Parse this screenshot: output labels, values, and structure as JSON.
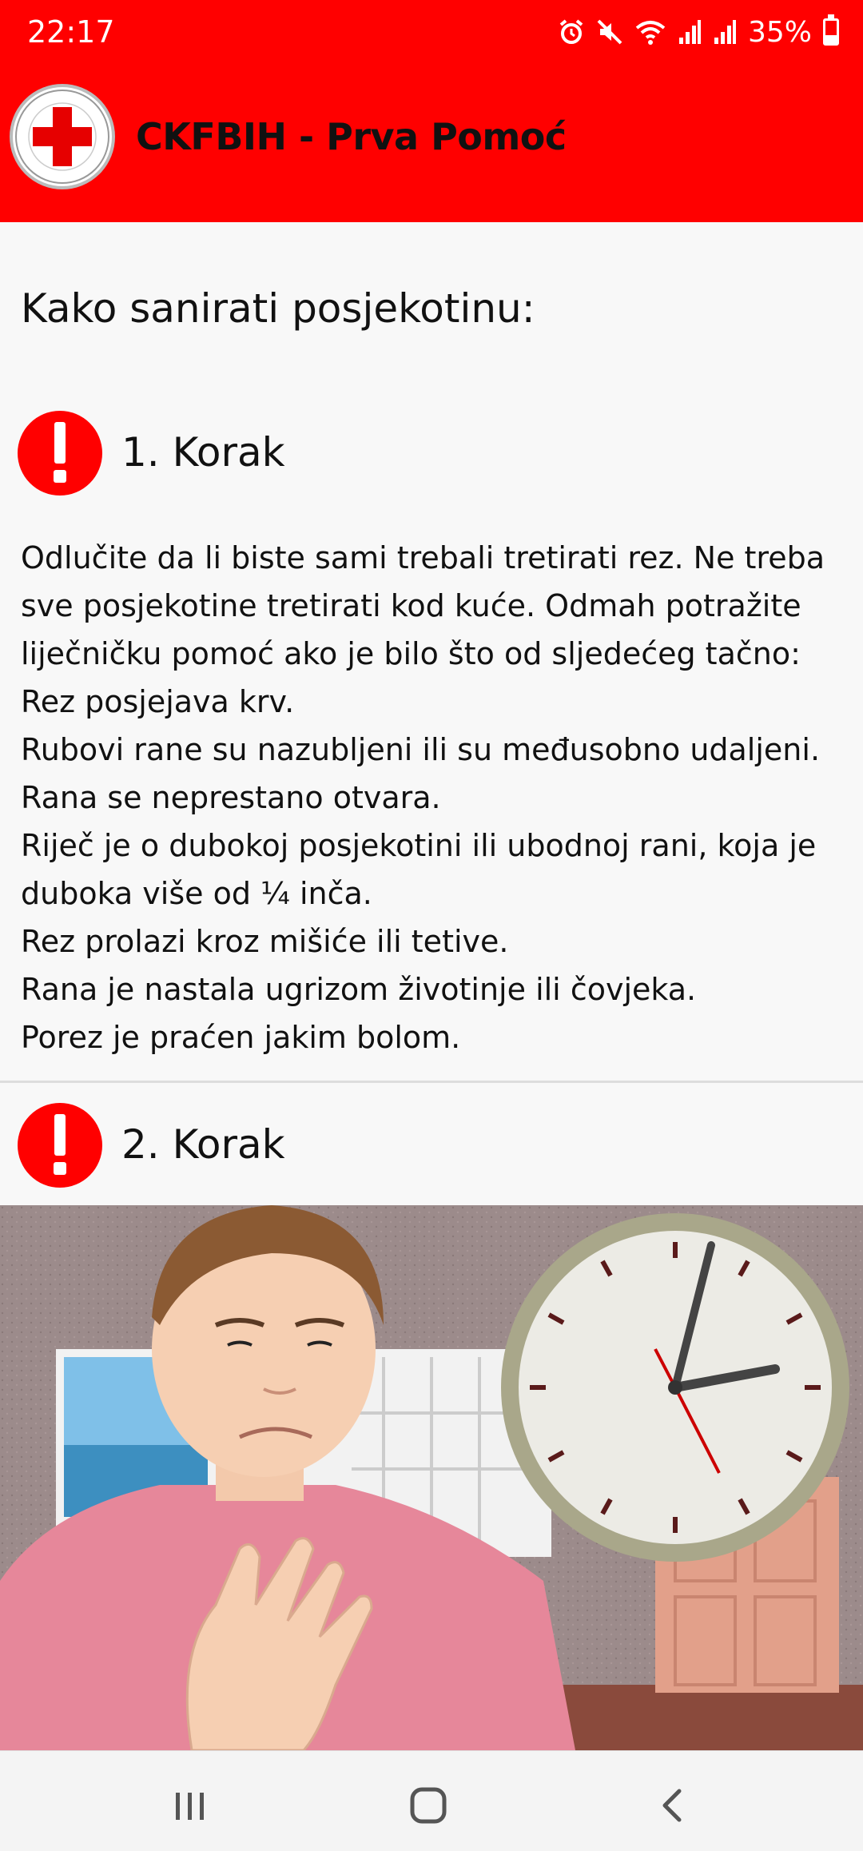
{
  "status_bar": {
    "time": "22:17",
    "battery_text": "35%",
    "battery_level": 0.35,
    "icons": [
      "alarm-icon",
      "mute-icon",
      "wifi-icon",
      "signal-icon",
      "signal-icon",
      "battery-icon"
    ]
  },
  "app_bar": {
    "title": "CKFBIH - Prva Pomoć",
    "logo": "red-cross-logo"
  },
  "page": {
    "title": "Kako sanirati posjekotinu:"
  },
  "steps": [
    {
      "label": "1. Korak",
      "icon": "alert-icon",
      "lines": [
        "Odlučite da li biste sami trebali tretirati rez. Ne treba sve posjekotine tretirati kod kuće. Odmah potražite liječničku pomoć ako je bilo što od sljedećeg tačno:",
        "Rez posjejava krv.",
        "Rubovi rane su nazubljeni ili su međusobno udaljeni.",
        "Rana se neprestano otvara.",
        "Riječ je o dubokoj posjekotini ili ubodnoj rani, koja je duboka više od ¼ inča.",
        "Rez prolazi kroz mišiće ili tetive.",
        "Rana je nastala ugrizom životinje ili čovjeka.",
        "Porez je praćen jakim bolom."
      ]
    },
    {
      "label": "2. Korak",
      "icon": "alert-icon"
    }
  ],
  "colors": {
    "brand_red": "#ff0000",
    "background": "#f8f8f8"
  },
  "nav_bar": {
    "icons": [
      "recent-apps-icon",
      "home-icon",
      "back-icon"
    ]
  }
}
